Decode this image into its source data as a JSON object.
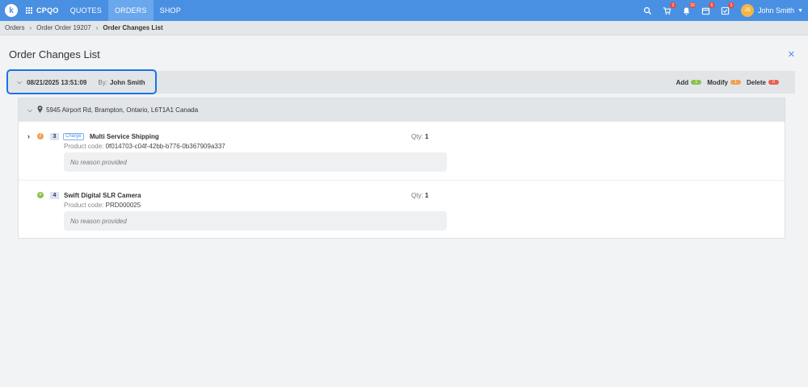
{
  "nav": {
    "brand": "CPQO",
    "items": [
      {
        "label": "QUOTES",
        "active": false
      },
      {
        "label": "ORDERS",
        "active": true
      },
      {
        "label": "SHOP",
        "active": false
      }
    ],
    "badges": {
      "cart": "2",
      "bell": "30",
      "calendar": "6",
      "tasks": "3"
    },
    "user_initials": "JS",
    "user_name": "John Smith",
    "accent": "#4a90e2"
  },
  "breadcrumb": {
    "items": [
      "Orders",
      "Order Order 19207"
    ],
    "current": "Order Changes List"
  },
  "page": {
    "title": "Order Changes List"
  },
  "change": {
    "date": "08/21/2025 13:51:09",
    "by_label": "By:",
    "user": "John Smith",
    "legend": [
      {
        "label": "Add",
        "count": "1",
        "color": "#8bc34a"
      },
      {
        "label": "Modify",
        "count": "1",
        "color": "#f0a050"
      },
      {
        "label": "Delete",
        "count": "0",
        "color": "#e8604c"
      }
    ]
  },
  "address": {
    "text": "5945 Airport Rd, Brampton, Ontario, L6T1A1 Canada"
  },
  "items": [
    {
      "number": "3",
      "tag": "Charge",
      "name": "Multi Service Shipping",
      "code_label": "Product code:",
      "code": "0f014703-c04f-42bb-b776-0b367909a337",
      "qty_label": "Qty:",
      "qty": "1",
      "reason": "No reason provided",
      "status": "modify"
    },
    {
      "number": "4",
      "name": "Swift Digital SLR Camera",
      "code_label": "Product code:",
      "code": "PRD000025",
      "qty_label": "Qty:",
      "qty": "1",
      "reason": "No reason provided",
      "status": "add"
    }
  ]
}
